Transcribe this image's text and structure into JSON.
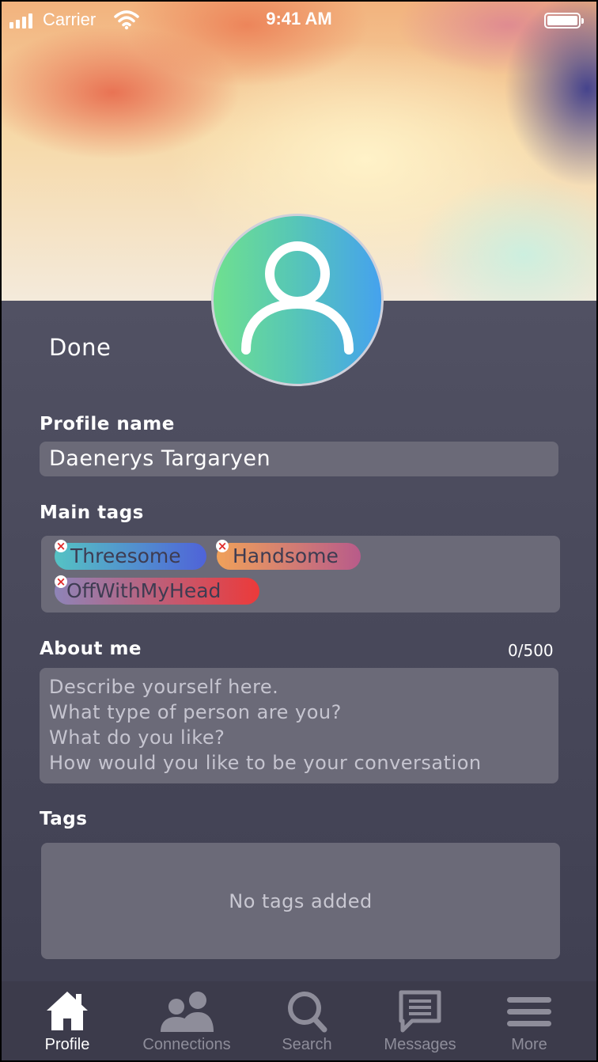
{
  "status_bar": {
    "carrier": "Carrier",
    "time": "9:41 AM"
  },
  "header": {
    "done_label": "Done",
    "avatar_icon": "user-icon"
  },
  "profile_name": {
    "label": "Profile name",
    "value": "Daenerys Targaryen"
  },
  "main_tags": {
    "label": "Main tags",
    "remove_icon": "remove-x-icon",
    "items": [
      {
        "label": "Threesome",
        "colors": [
          "#55c2c4",
          "#4f63d8"
        ]
      },
      {
        "label": "Handsome",
        "colors": [
          "#f0a15a",
          "#b85b8a"
        ]
      },
      {
        "label": "OffWithMyHead",
        "colors": [
          "#8e84b8",
          "#ec3a3a"
        ]
      }
    ]
  },
  "about_me": {
    "label": "About me",
    "counter": "0/500",
    "placeholder_lines": [
      "Describe yourself here.",
      "What type of person are you?",
      "What do you like?",
      "How would you like to be your conversation"
    ]
  },
  "tags": {
    "label": "Tags",
    "empty_text": "No tags added"
  },
  "tab_bar": {
    "active_index": 0,
    "items": [
      {
        "label": "Profile",
        "icon": "home-icon"
      },
      {
        "label": "Connections",
        "icon": "people-icon"
      },
      {
        "label": "Search",
        "icon": "search-icon"
      },
      {
        "label": "Messages",
        "icon": "message-icon"
      },
      {
        "label": "More",
        "icon": "menu-icon"
      }
    ]
  }
}
